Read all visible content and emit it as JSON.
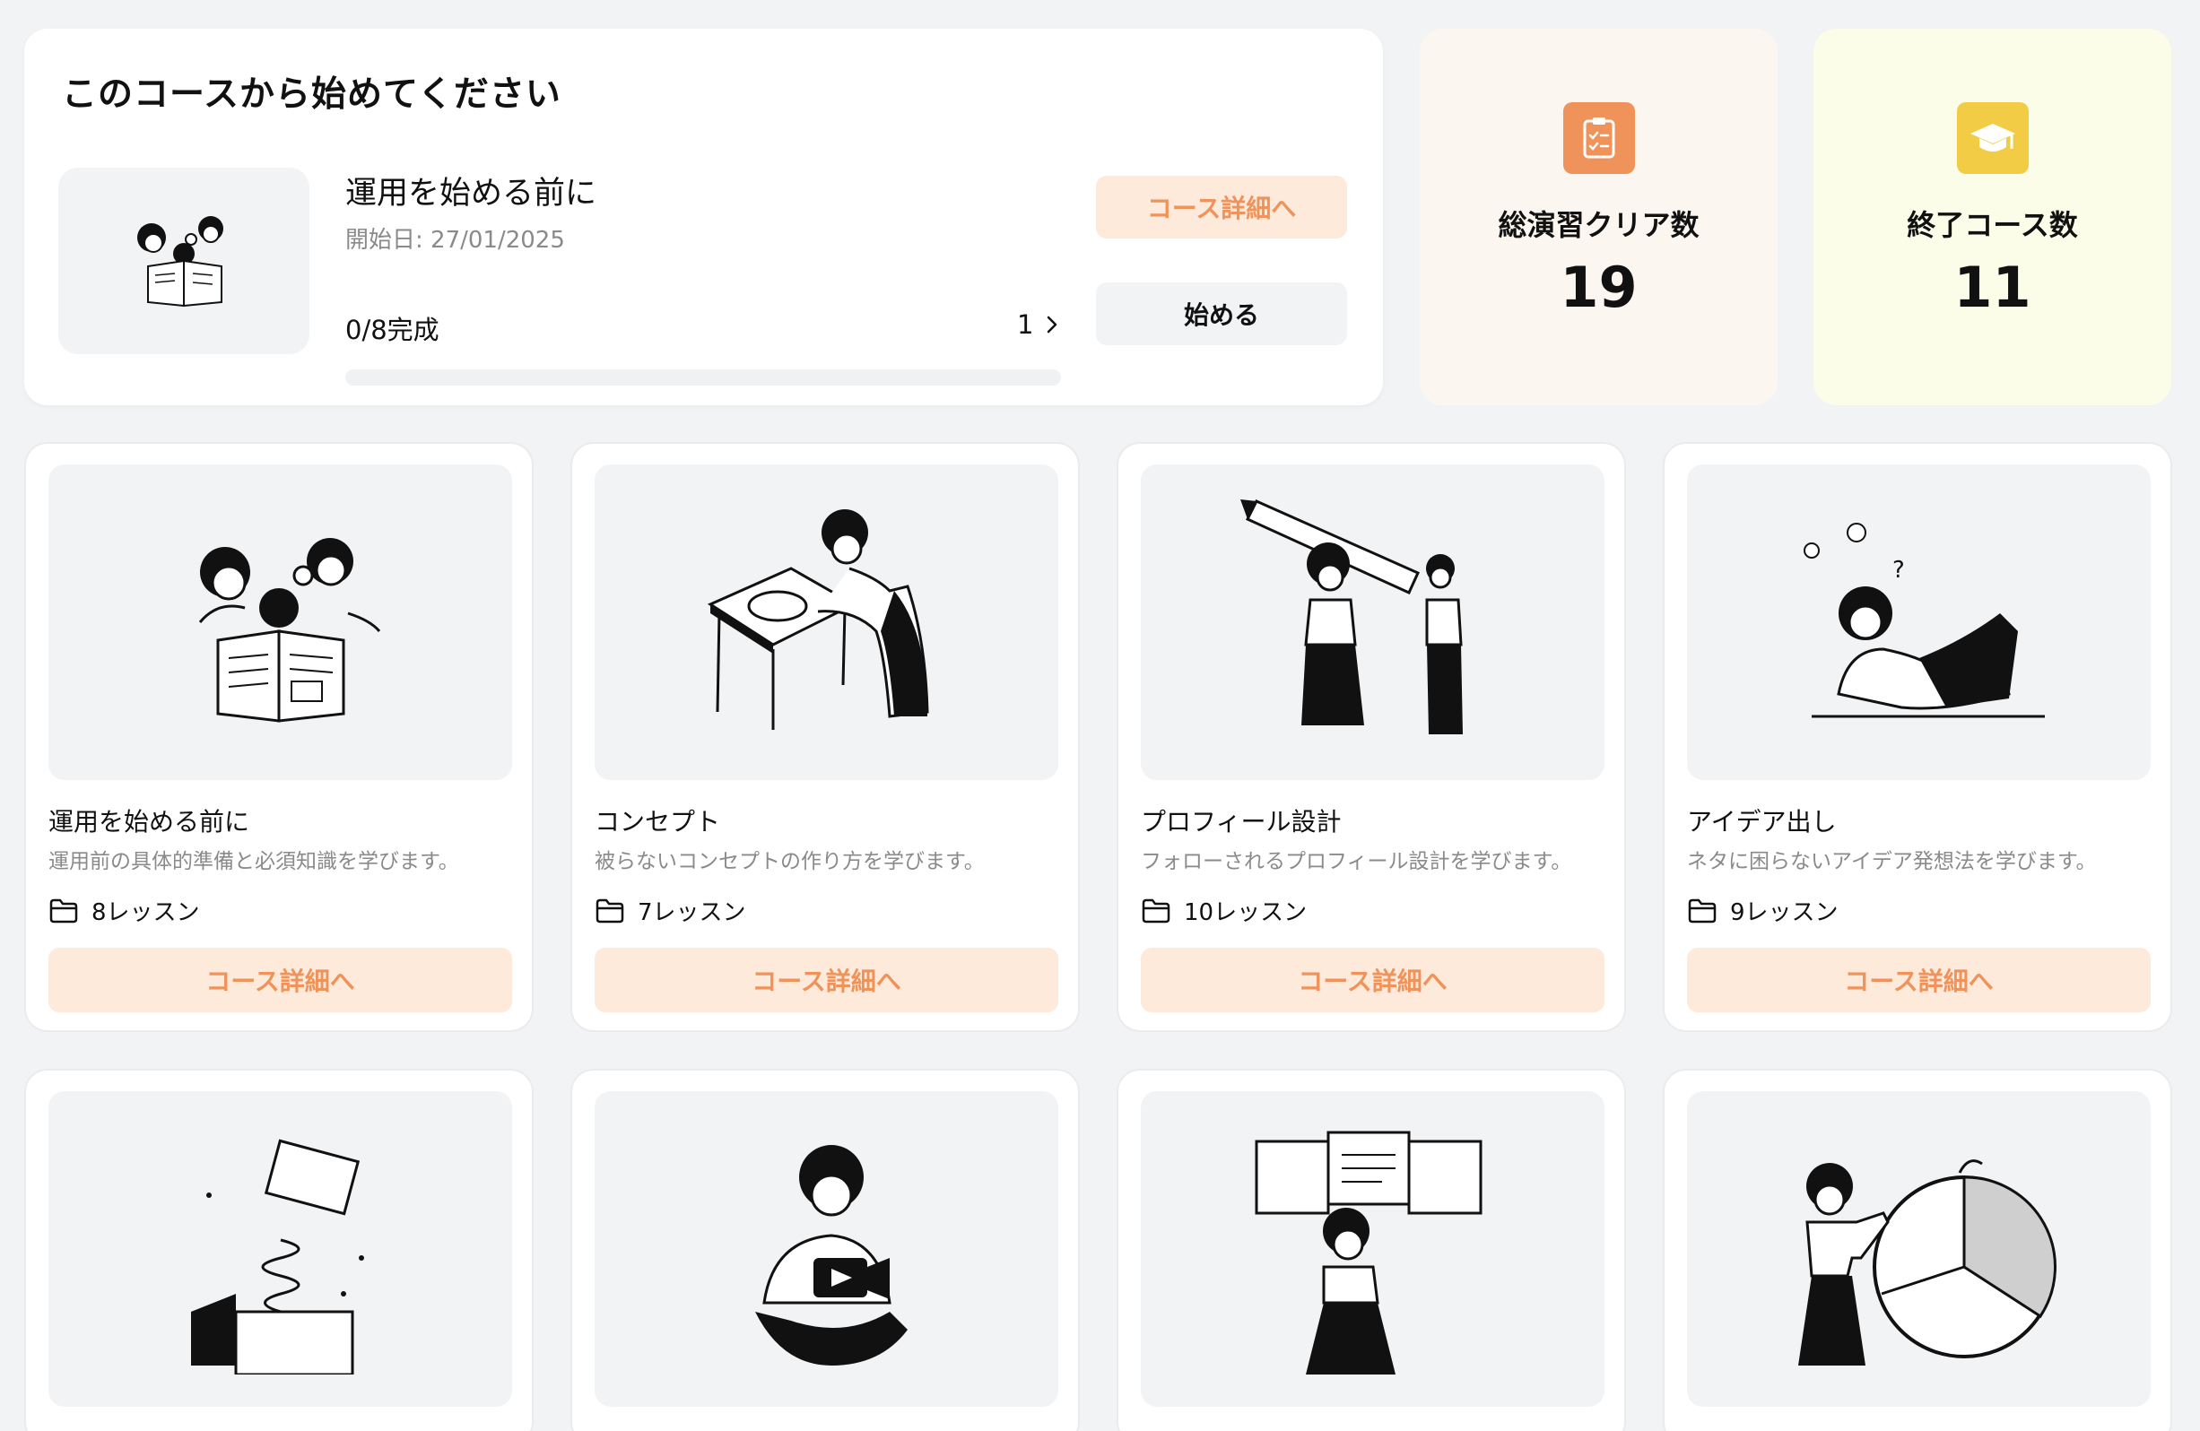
{
  "featured": {
    "heading": "このコースから始めてください",
    "course_name": "運用を始める前に",
    "start_date": "開始日: 27/01/2025",
    "progress_text": "0/8完成",
    "progress_fraction": 0,
    "lesson_indicator": "1",
    "detail_button": "コース詳細へ",
    "start_button": "始める"
  },
  "stats": {
    "exercises": {
      "label": "総演習クリア数",
      "value": "19",
      "icon": "clipboard-check-icon",
      "color": "#f0935a"
    },
    "courses": {
      "label": "終了コース数",
      "value": "11",
      "icon": "graduation-cap-icon",
      "color": "#f2cc45"
    }
  },
  "courses": [
    {
      "title": "運用を始める前に",
      "desc": "運用前の具体的準備と必須知識を学びます。",
      "lessons": "8レッスン",
      "button": "コース詳細へ",
      "illustration": "reading-newspaper"
    },
    {
      "title": "コンセプト",
      "desc": "被らないコンセプトの作り方を学びます。",
      "lessons": "7レッスン",
      "button": "コース詳細へ",
      "illustration": "pottery-wheel"
    },
    {
      "title": "プロフィール設計",
      "desc": "フォローされるプロフィール設計を学びます。",
      "lessons": "10レッスン",
      "button": "コース詳細へ",
      "illustration": "giant-pencil"
    },
    {
      "title": "アイデア出し",
      "desc": "ネタに困らないアイデア発想法を学びます。",
      "lessons": "9レッスン",
      "button": "コース詳細へ",
      "illustration": "thinking-lightbulbs"
    },
    {
      "illustration": "jack-in-the-box"
    },
    {
      "illustration": "video-camera"
    },
    {
      "illustration": "whiteboard-presentation"
    },
    {
      "illustration": "pie-chart"
    }
  ],
  "colors": {
    "accent": "#f0935a",
    "accent_light": "#fdeadb",
    "background": "#f2f3f5"
  }
}
